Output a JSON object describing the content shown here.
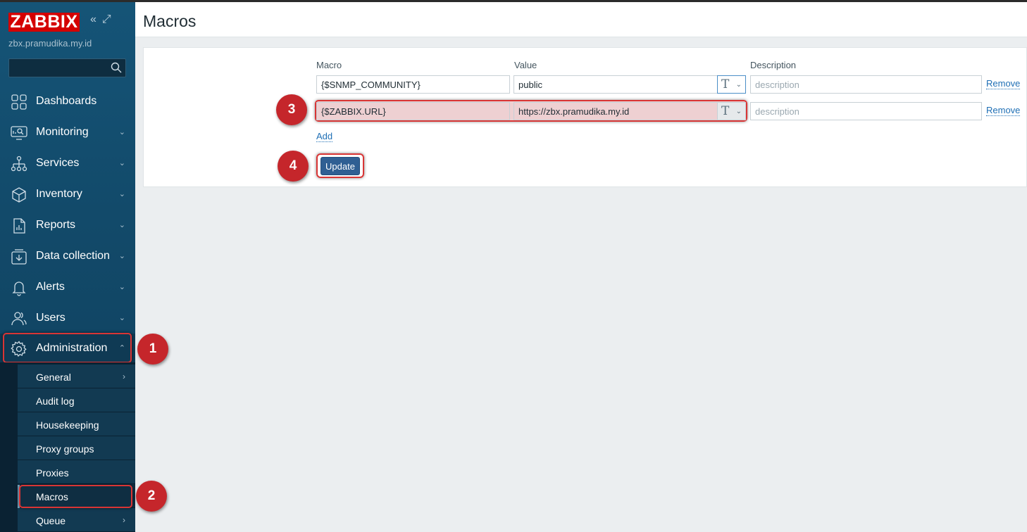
{
  "app": {
    "logo_text": "ZABBIX",
    "server_name": "zbx.pramudika.my.id",
    "search_placeholder": ""
  },
  "sidebar": {
    "items": [
      {
        "label": "Dashboards",
        "icon": "dashboards-icon"
      },
      {
        "label": "Monitoring",
        "icon": "monitoring-icon"
      },
      {
        "label": "Services",
        "icon": "services-icon"
      },
      {
        "label": "Inventory",
        "icon": "inventory-icon"
      },
      {
        "label": "Reports",
        "icon": "reports-icon"
      },
      {
        "label": "Data collection",
        "icon": "data-collection-icon"
      },
      {
        "label": "Alerts",
        "icon": "alerts-icon"
      },
      {
        "label": "Users",
        "icon": "users-icon"
      },
      {
        "label": "Administration",
        "icon": "gear-icon"
      }
    ],
    "submenu": [
      {
        "label": "General"
      },
      {
        "label": "Audit log"
      },
      {
        "label": "Housekeeping"
      },
      {
        "label": "Proxy groups"
      },
      {
        "label": "Proxies"
      },
      {
        "label": "Macros"
      },
      {
        "label": "Queue"
      }
    ]
  },
  "header": {
    "title": "Macros"
  },
  "macros_table": {
    "columns": [
      "Macro",
      "Value",
      "Description"
    ],
    "rows": [
      {
        "macro": "{$SNMP_COMMUNITY}",
        "value": "public",
        "description_placeholder": "description",
        "remove_label": "Remove"
      },
      {
        "macro": "{$ZABBIX.URL}",
        "value": "https://zbx.pramudika.my.id",
        "description_placeholder": "description",
        "remove_label": "Remove"
      }
    ],
    "type_glyph": "T",
    "add_label": "Add",
    "update_label": "Update"
  },
  "annotations": [
    "1",
    "2",
    "3",
    "4"
  ],
  "colors": {
    "brand_red": "#d40000",
    "sidebar": "#155477",
    "highlight": "#d93535",
    "link": "#1f6fb5",
    "button": "#2f5f93"
  }
}
